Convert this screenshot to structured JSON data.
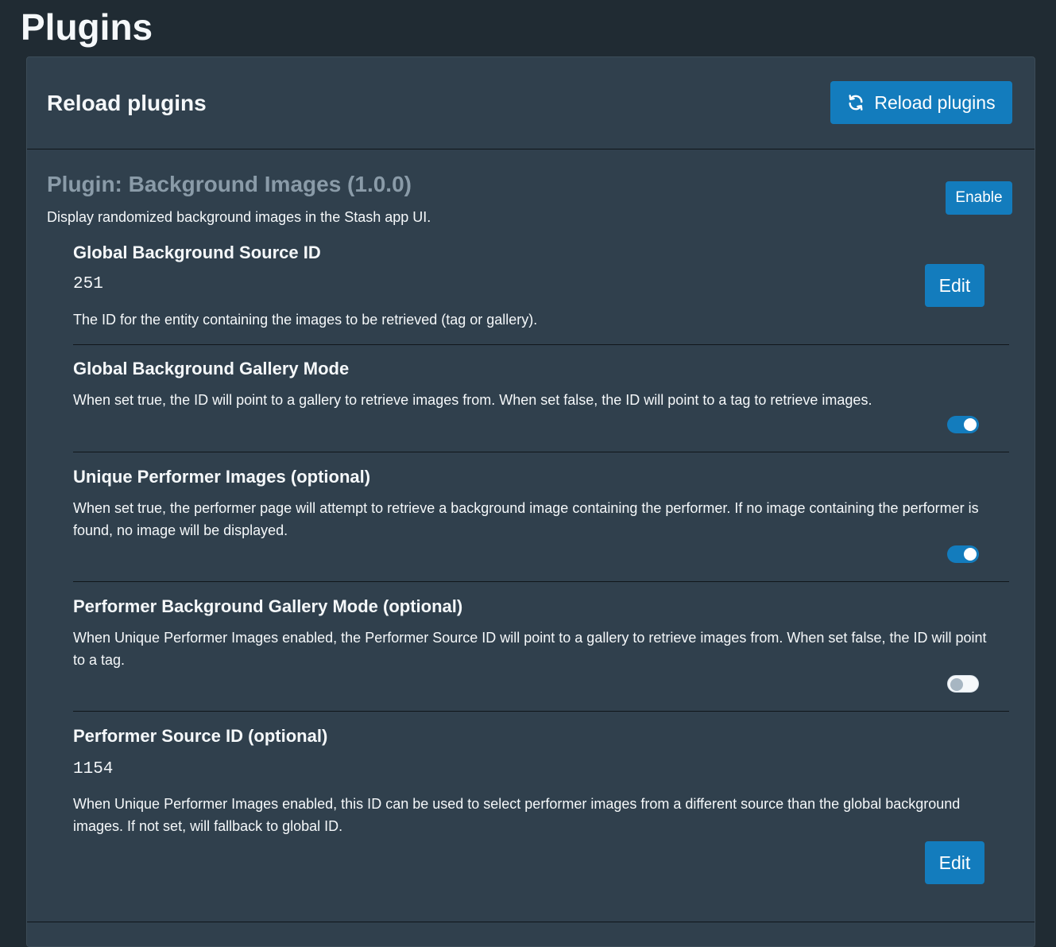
{
  "page": {
    "title": "Plugins"
  },
  "reload": {
    "heading": "Reload plugins",
    "button_label": "Reload plugins",
    "button_icon": "refresh-icon"
  },
  "plugin": {
    "title": "Plugin: Background Images (1.0.0)",
    "description": "Display randomized background images in the Stash app UI.",
    "enable_label": "Enable"
  },
  "settings": [
    {
      "title": "Global Background Source ID",
      "value": "251",
      "description": "The ID for the entity containing the images to be retrieved (tag or gallery).",
      "edit_label": "Edit"
    },
    {
      "title": "Global Background Gallery Mode",
      "description": "When set true, the ID will point to a gallery to retrieve images from. When set false, the ID will point to a tag to retrieve images.",
      "enabled": true
    },
    {
      "title": "Unique Performer Images (optional)",
      "description": "When set true, the performer page will attempt to retrieve a background image containing the performer. If no image containing the performer is found, no image will be displayed.",
      "enabled": true
    },
    {
      "title": "Performer Background Gallery Mode (optional)",
      "description": "When Unique Performer Images enabled, the Performer Source ID will point to a gallery to retrieve images from. When set false, the ID will point to a tag.",
      "enabled": false
    },
    {
      "title": "Performer Source ID (optional)",
      "value": "1154",
      "description": "When Unique Performer Images enabled, this ID can be used to select performer images from a different source than the global background images. If not set, will fallback to global ID.",
      "edit_label": "Edit"
    }
  ],
  "colors": {
    "background": "#202b33",
    "card": "#30404d",
    "accent": "#137cbd",
    "muted_title": "#8a9ba8"
  }
}
